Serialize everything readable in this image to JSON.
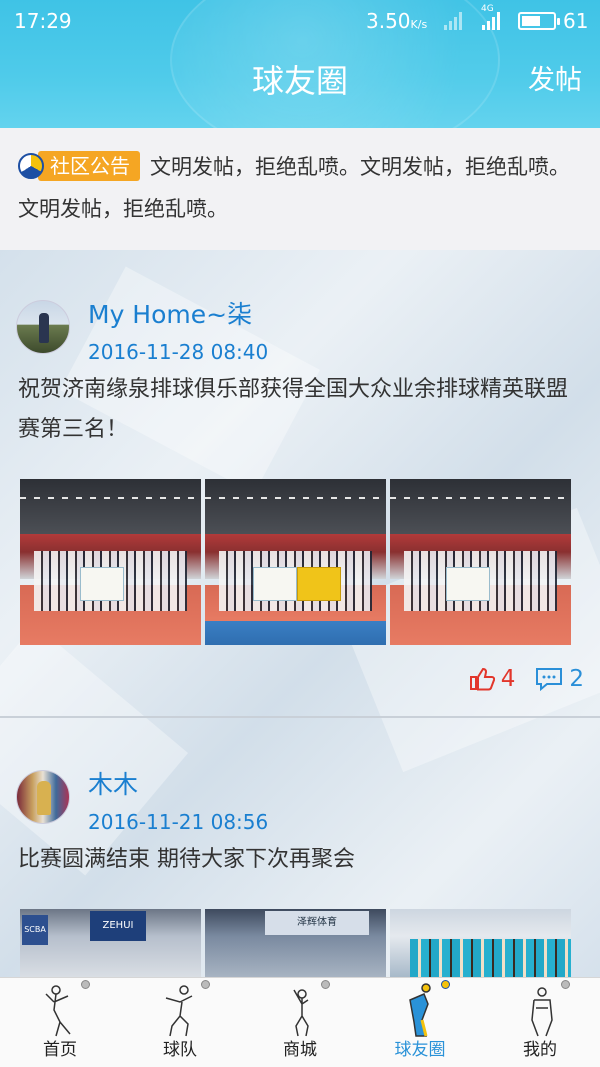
{
  "status_bar": {
    "time": "17:29",
    "speed": "3.50",
    "speed_unit": "K/s",
    "network": "4G",
    "battery": "61",
    "battery_fraction": 0.61
  },
  "header": {
    "title": "球友圈",
    "post_button": "发帖"
  },
  "notice": {
    "tag": "社区公告",
    "text": "文明发帖，拒绝乱喷。文明发帖，拒绝乱喷。文明发帖，拒绝乱喷。"
  },
  "posts": [
    {
      "username": "My Home~柒",
      "time": "2016-11-28 08:40",
      "content": "祝贺济南缘泉排球俱乐部获得全国大众业余排球精英联盟赛第三名！",
      "likes": "4",
      "comments": "2"
    },
    {
      "username": "木木",
      "time": "2016-11-21 08:56",
      "content": "比赛圆满结束 期待大家下次再聚会",
      "photo_signs": [
        "SCBA",
        "ZEHUI",
        "泽辉体育"
      ]
    }
  ],
  "tabs": [
    {
      "label": "首页",
      "icon": "home-player-icon"
    },
    {
      "label": "球队",
      "icon": "team-player-icon"
    },
    {
      "label": "商城",
      "icon": "shop-player-icon"
    },
    {
      "label": "球友圈",
      "icon": "circle-player-icon"
    },
    {
      "label": "我的",
      "icon": "profile-player-icon"
    }
  ],
  "colors": {
    "header": "#4fcbea",
    "accent": "#1a7fd0",
    "notice_tag": "#f5a623",
    "like": "#e2362b",
    "comment": "#2a8fd8",
    "active_tab": "#2a92d8"
  }
}
